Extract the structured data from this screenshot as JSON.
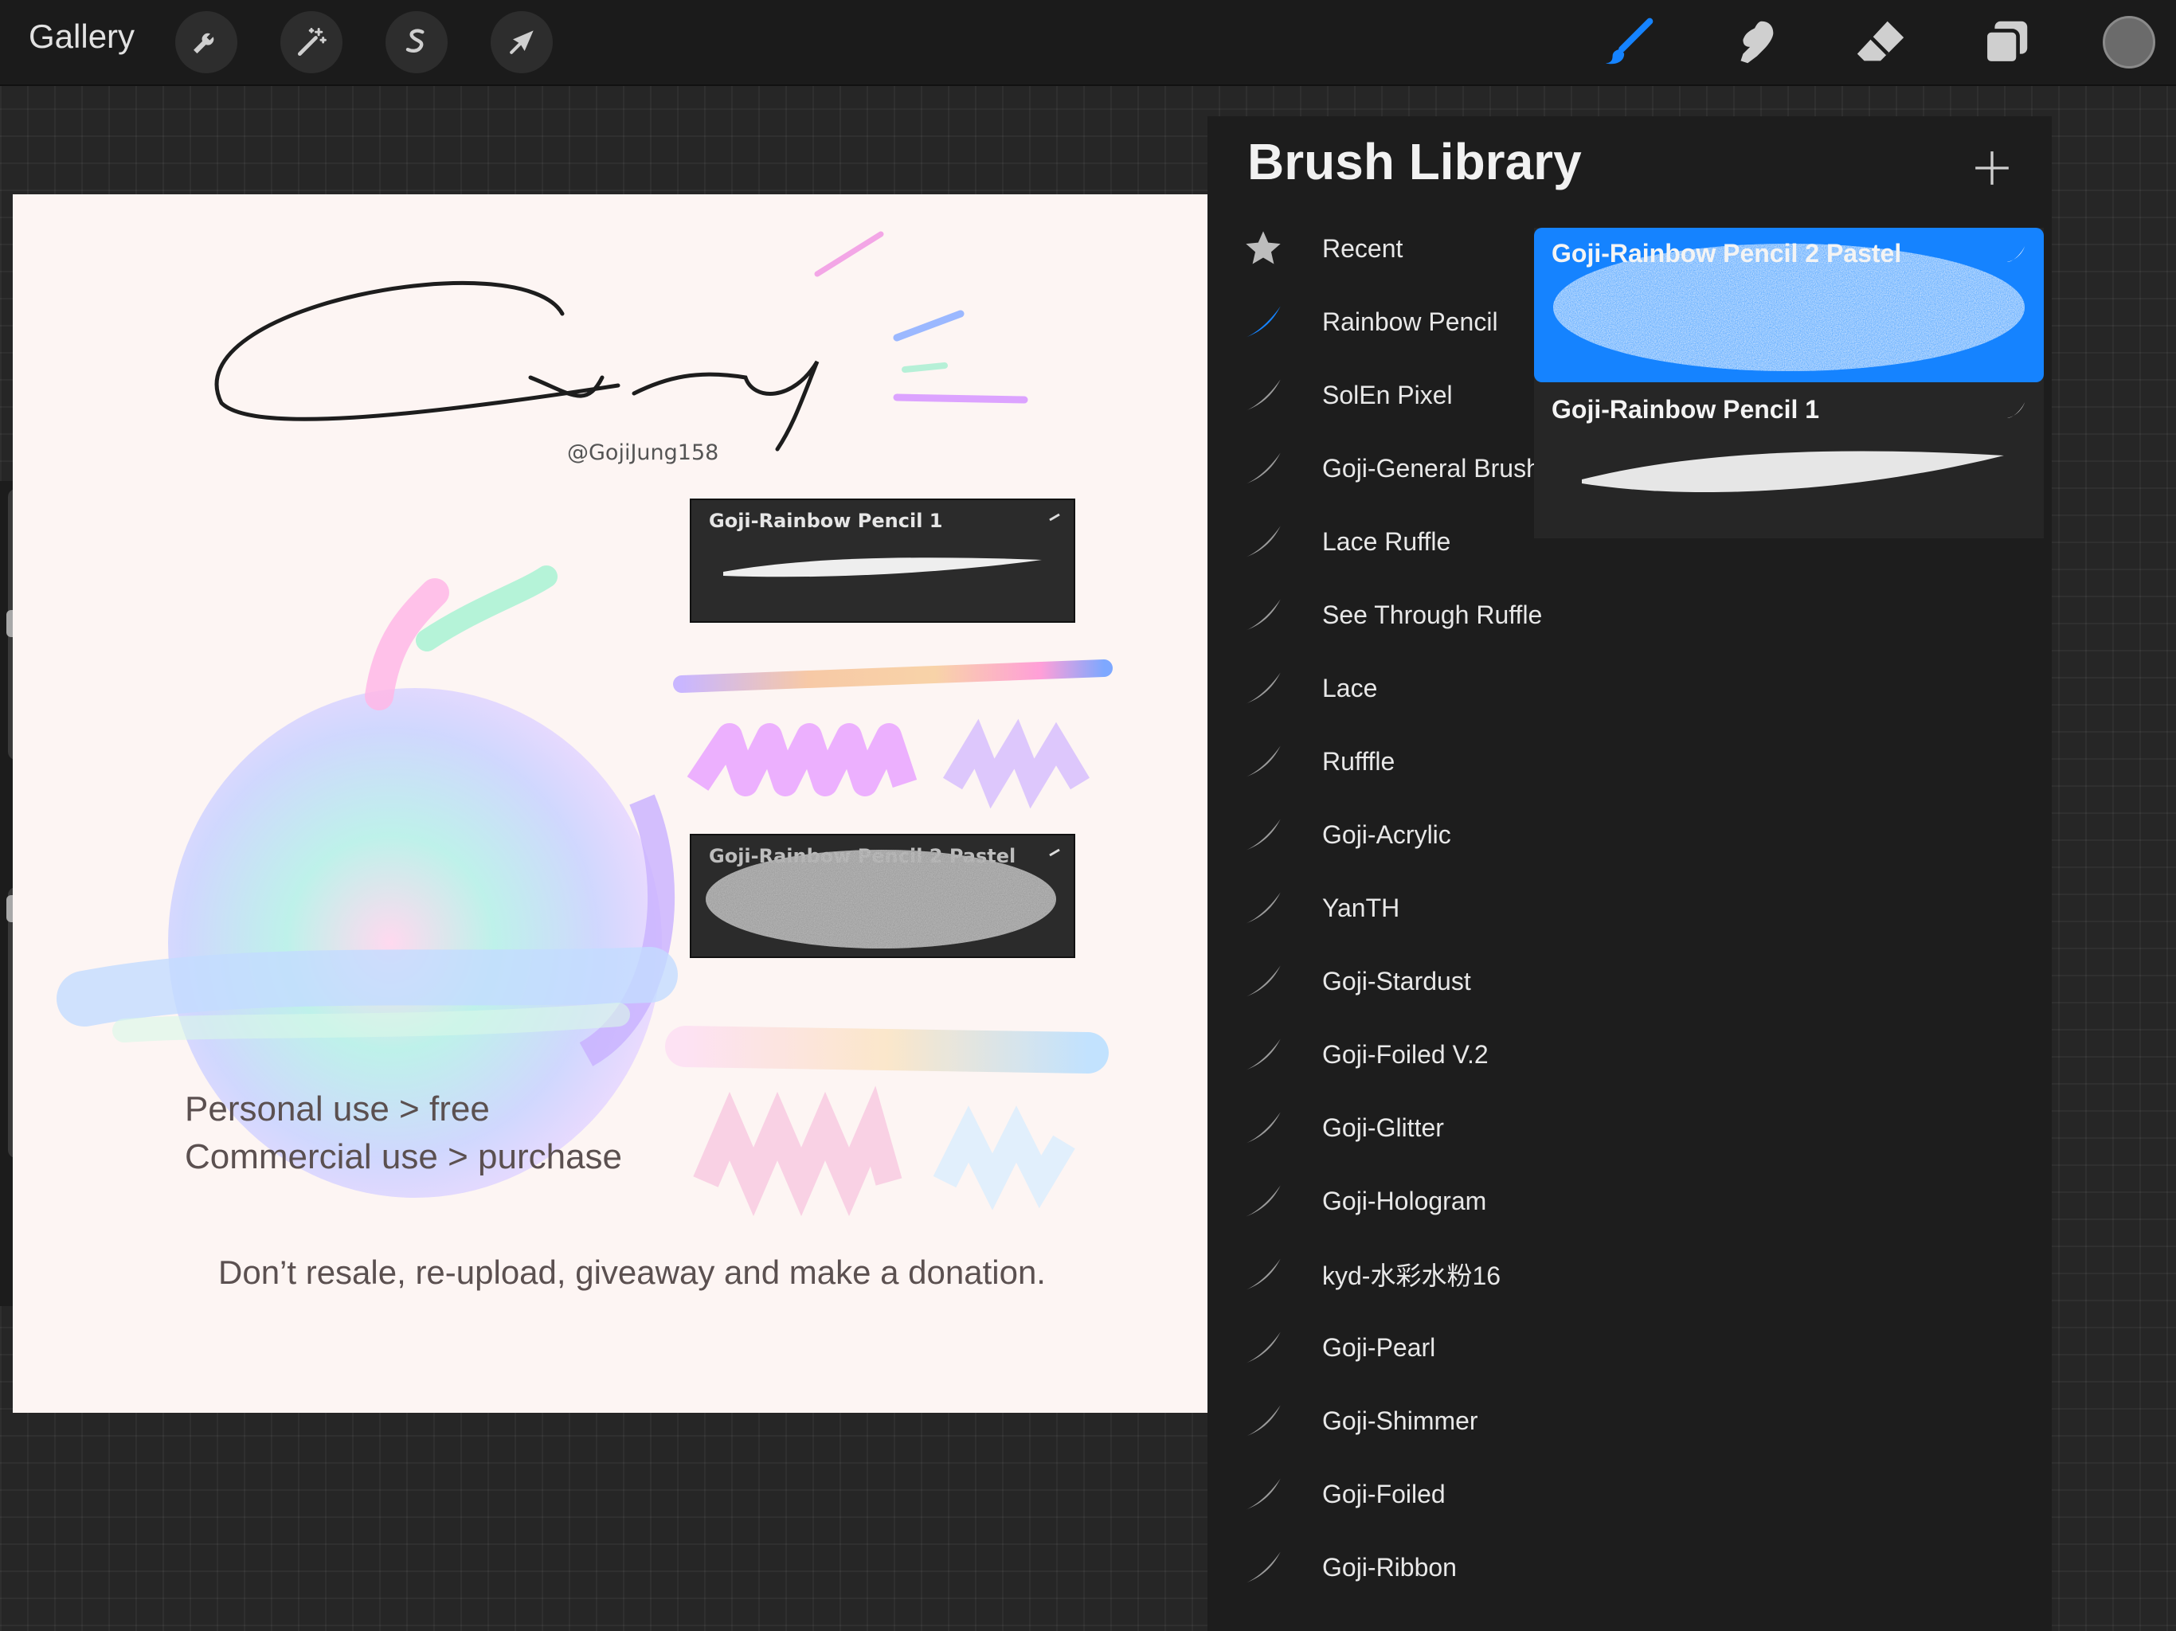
{
  "topbar": {
    "gallery_label": "Gallery",
    "left_tools": [
      "actions-wrench",
      "adjustments-wand",
      "selection-s",
      "transform-arrow"
    ],
    "right_tools": [
      "paint-brush",
      "smudge",
      "eraser",
      "layers"
    ],
    "active_color": "#6b6b6b",
    "accent_color": "#1583ff"
  },
  "canvas": {
    "handle": "@GojiJung158",
    "card1_title": "Goji-Rainbow Pencil 1",
    "card2_title": "Goji-Rainbow Pencil 2 Pastel",
    "license_line1": "Personal use > free",
    "license_line2": "Commercial use > purchase",
    "notice": "Don’t resale, re-upload, giveaway and make a donation."
  },
  "library": {
    "title": "Brush Library",
    "categories": [
      {
        "label": "Recent",
        "icon": "star-icon"
      },
      {
        "label": "Rainbow Pencil",
        "icon": "brush-stroke-icon",
        "active": true
      },
      {
        "label": "SolEn Pixel",
        "icon": "brush-stroke-icon"
      },
      {
        "label": "Goji-General Brush",
        "icon": "brush-stroke-icon"
      },
      {
        "label": "Lace Ruffle",
        "icon": "brush-stroke-icon"
      },
      {
        "label": "See Through Ruffle",
        "icon": "brush-stroke-icon"
      },
      {
        "label": "Lace",
        "icon": "brush-stroke-icon"
      },
      {
        "label": "Rufffle",
        "icon": "brush-stroke-icon"
      },
      {
        "label": "Goji-Acrylic",
        "icon": "brush-stroke-icon"
      },
      {
        "label": "YanTH",
        "icon": "brush-stroke-icon"
      },
      {
        "label": "Goji-Stardust",
        "icon": "brush-stroke-icon"
      },
      {
        "label": "Goji-Foiled V.2",
        "icon": "brush-stroke-icon"
      },
      {
        "label": "Goji-Glitter",
        "icon": "brush-stroke-icon"
      },
      {
        "label": "Goji-Hologram",
        "icon": "brush-stroke-icon"
      },
      {
        "label": "kyd-水彩水粉16",
        "icon": "brush-stroke-icon"
      },
      {
        "label": "Goji-Pearl",
        "icon": "brush-stroke-icon"
      },
      {
        "label": "Goji-Shimmer",
        "icon": "brush-stroke-icon"
      },
      {
        "label": "Goji-Foiled",
        "icon": "brush-stroke-icon"
      },
      {
        "label": "Goji-Ribbon",
        "icon": "brush-stroke-icon"
      }
    ],
    "brushes": [
      {
        "name": "Goji-Rainbow Pencil 2 Pastel",
        "selected": true
      },
      {
        "name": "Goji-Rainbow Pencil 1",
        "selected": false
      }
    ]
  }
}
